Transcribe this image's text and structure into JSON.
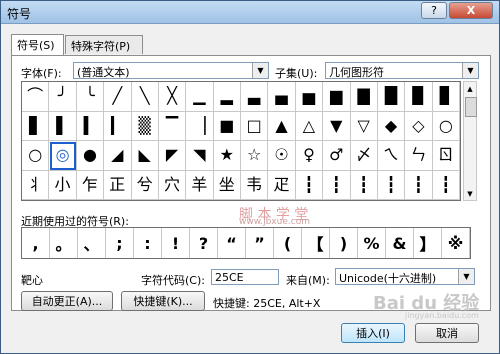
{
  "window": {
    "title": "符号",
    "help": "?",
    "close": "X"
  },
  "tabs": [
    "符号(S)",
    "特殊字符(P)"
  ],
  "font": {
    "label": "字体(F):",
    "value": "(普通文本)"
  },
  "subset": {
    "label": "子集(U):",
    "value": "几何图形符"
  },
  "symbols": [
    [
      "⌒",
      "╯",
      "╰",
      "╱",
      "╲",
      "╳",
      "▁",
      "▂",
      "▃",
      "▄",
      "▅",
      "▆",
      "▇",
      "█",
      "▉",
      "▊"
    ],
    [
      "▋",
      "▌",
      "▍",
      "▎",
      "▒",
      "▔",
      "▕",
      "■",
      "□",
      "▲",
      "△",
      "▼",
      "▽",
      "◆",
      "◇",
      "○"
    ],
    [
      "○",
      "◎",
      "●",
      "◢",
      "◣",
      "◤",
      "◥",
      "★",
      "☆",
      "☉",
      "♀",
      "♂",
      "〆",
      "ㄟ",
      "ㄣ",
      "ㄖ"
    ],
    [
      "丬",
      "小",
      "乍",
      "正",
      "兮",
      "穴",
      "羊",
      "坐",
      "韦",
      "疋",
      "┇",
      "┇",
      "┇",
      "┇",
      "┇",
      "┇"
    ]
  ],
  "selected_symbol": "◎",
  "recent_label": "近期使用过的符号(R):",
  "recent": [
    ",",
    "。",
    "、",
    ";",
    ":",
    "!",
    "?",
    "“",
    "”",
    "(",
    "【",
    ")",
    "%",
    "&",
    "】",
    "※"
  ],
  "char_name": "靶心",
  "char_code": {
    "label": "字符代码(C):",
    "value": "25CE"
  },
  "from": {
    "label": "来自(M):",
    "value": "Unicode(十六进制)"
  },
  "autocorrect_button": "自动更正(A)...",
  "shortcut_key_button": "快捷键(K)...",
  "shortcut_info": "快捷键: 25CE, Alt+X",
  "insert_button": "插入(I)",
  "cancel_button": "取消",
  "watermarks": {
    "cn": "脚 本 学 堂",
    "url": "www.jbxue.com",
    "baidu": "Bai du 经验",
    "baidu_url": "jingyan.baidu.com"
  }
}
